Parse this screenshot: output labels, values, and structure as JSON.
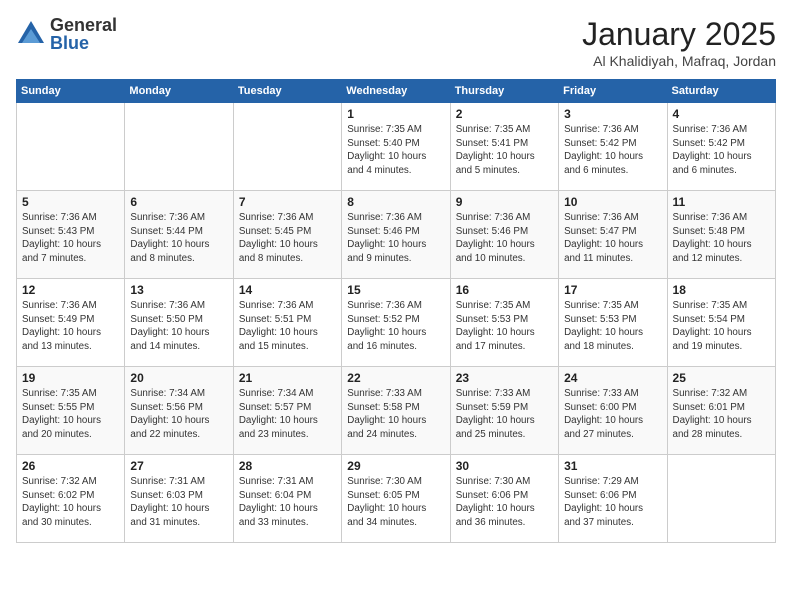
{
  "logo": {
    "general": "General",
    "blue": "Blue"
  },
  "title": "January 2025",
  "location": "Al Khalidiyah, Mafraq, Jordan",
  "weekdays": [
    "Sunday",
    "Monday",
    "Tuesday",
    "Wednesday",
    "Thursday",
    "Friday",
    "Saturday"
  ],
  "weeks": [
    [
      {
        "day": "",
        "info": ""
      },
      {
        "day": "",
        "info": ""
      },
      {
        "day": "",
        "info": ""
      },
      {
        "day": "1",
        "info": "Sunrise: 7:35 AM\nSunset: 5:40 PM\nDaylight: 10 hours\nand 4 minutes."
      },
      {
        "day": "2",
        "info": "Sunrise: 7:35 AM\nSunset: 5:41 PM\nDaylight: 10 hours\nand 5 minutes."
      },
      {
        "day": "3",
        "info": "Sunrise: 7:36 AM\nSunset: 5:42 PM\nDaylight: 10 hours\nand 6 minutes."
      },
      {
        "day": "4",
        "info": "Sunrise: 7:36 AM\nSunset: 5:42 PM\nDaylight: 10 hours\nand 6 minutes."
      }
    ],
    [
      {
        "day": "5",
        "info": "Sunrise: 7:36 AM\nSunset: 5:43 PM\nDaylight: 10 hours\nand 7 minutes."
      },
      {
        "day": "6",
        "info": "Sunrise: 7:36 AM\nSunset: 5:44 PM\nDaylight: 10 hours\nand 8 minutes."
      },
      {
        "day": "7",
        "info": "Sunrise: 7:36 AM\nSunset: 5:45 PM\nDaylight: 10 hours\nand 8 minutes."
      },
      {
        "day": "8",
        "info": "Sunrise: 7:36 AM\nSunset: 5:46 PM\nDaylight: 10 hours\nand 9 minutes."
      },
      {
        "day": "9",
        "info": "Sunrise: 7:36 AM\nSunset: 5:46 PM\nDaylight: 10 hours\nand 10 minutes."
      },
      {
        "day": "10",
        "info": "Sunrise: 7:36 AM\nSunset: 5:47 PM\nDaylight: 10 hours\nand 11 minutes."
      },
      {
        "day": "11",
        "info": "Sunrise: 7:36 AM\nSunset: 5:48 PM\nDaylight: 10 hours\nand 12 minutes."
      }
    ],
    [
      {
        "day": "12",
        "info": "Sunrise: 7:36 AM\nSunset: 5:49 PM\nDaylight: 10 hours\nand 13 minutes."
      },
      {
        "day": "13",
        "info": "Sunrise: 7:36 AM\nSunset: 5:50 PM\nDaylight: 10 hours\nand 14 minutes."
      },
      {
        "day": "14",
        "info": "Sunrise: 7:36 AM\nSunset: 5:51 PM\nDaylight: 10 hours\nand 15 minutes."
      },
      {
        "day": "15",
        "info": "Sunrise: 7:36 AM\nSunset: 5:52 PM\nDaylight: 10 hours\nand 16 minutes."
      },
      {
        "day": "16",
        "info": "Sunrise: 7:35 AM\nSunset: 5:53 PM\nDaylight: 10 hours\nand 17 minutes."
      },
      {
        "day": "17",
        "info": "Sunrise: 7:35 AM\nSunset: 5:53 PM\nDaylight: 10 hours\nand 18 minutes."
      },
      {
        "day": "18",
        "info": "Sunrise: 7:35 AM\nSunset: 5:54 PM\nDaylight: 10 hours\nand 19 minutes."
      }
    ],
    [
      {
        "day": "19",
        "info": "Sunrise: 7:35 AM\nSunset: 5:55 PM\nDaylight: 10 hours\nand 20 minutes."
      },
      {
        "day": "20",
        "info": "Sunrise: 7:34 AM\nSunset: 5:56 PM\nDaylight: 10 hours\nand 22 minutes."
      },
      {
        "day": "21",
        "info": "Sunrise: 7:34 AM\nSunset: 5:57 PM\nDaylight: 10 hours\nand 23 minutes."
      },
      {
        "day": "22",
        "info": "Sunrise: 7:33 AM\nSunset: 5:58 PM\nDaylight: 10 hours\nand 24 minutes."
      },
      {
        "day": "23",
        "info": "Sunrise: 7:33 AM\nSunset: 5:59 PM\nDaylight: 10 hours\nand 25 minutes."
      },
      {
        "day": "24",
        "info": "Sunrise: 7:33 AM\nSunset: 6:00 PM\nDaylight: 10 hours\nand 27 minutes."
      },
      {
        "day": "25",
        "info": "Sunrise: 7:32 AM\nSunset: 6:01 PM\nDaylight: 10 hours\nand 28 minutes."
      }
    ],
    [
      {
        "day": "26",
        "info": "Sunrise: 7:32 AM\nSunset: 6:02 PM\nDaylight: 10 hours\nand 30 minutes."
      },
      {
        "day": "27",
        "info": "Sunrise: 7:31 AM\nSunset: 6:03 PM\nDaylight: 10 hours\nand 31 minutes."
      },
      {
        "day": "28",
        "info": "Sunrise: 7:31 AM\nSunset: 6:04 PM\nDaylight: 10 hours\nand 33 minutes."
      },
      {
        "day": "29",
        "info": "Sunrise: 7:30 AM\nSunset: 6:05 PM\nDaylight: 10 hours\nand 34 minutes."
      },
      {
        "day": "30",
        "info": "Sunrise: 7:30 AM\nSunset: 6:06 PM\nDaylight: 10 hours\nand 36 minutes."
      },
      {
        "day": "31",
        "info": "Sunrise: 7:29 AM\nSunset: 6:06 PM\nDaylight: 10 hours\nand 37 minutes."
      },
      {
        "day": "",
        "info": ""
      }
    ]
  ]
}
